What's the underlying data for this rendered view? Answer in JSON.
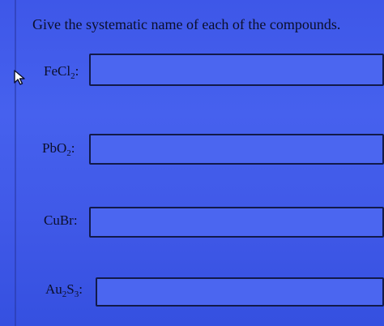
{
  "question": {
    "instruction": "Give the systematic name of each of the compounds."
  },
  "compounds": [
    {
      "base1": "FeCl",
      "sub1": "2",
      "base2": "",
      "sub2": "",
      "colon": ":",
      "answer": ""
    },
    {
      "base1": "PbO",
      "sub1": "2",
      "base2": "",
      "sub2": "",
      "colon": ":",
      "answer": ""
    },
    {
      "base1": "CuBr",
      "sub1": "",
      "base2": "",
      "sub2": "",
      "colon": ":",
      "answer": ""
    },
    {
      "base1": "Au",
      "sub1": "2",
      "base2": "S",
      "sub2": "3",
      "colon": ":",
      "answer": ""
    }
  ],
  "icons": {
    "cursor": "mouse-pointer-icon"
  }
}
